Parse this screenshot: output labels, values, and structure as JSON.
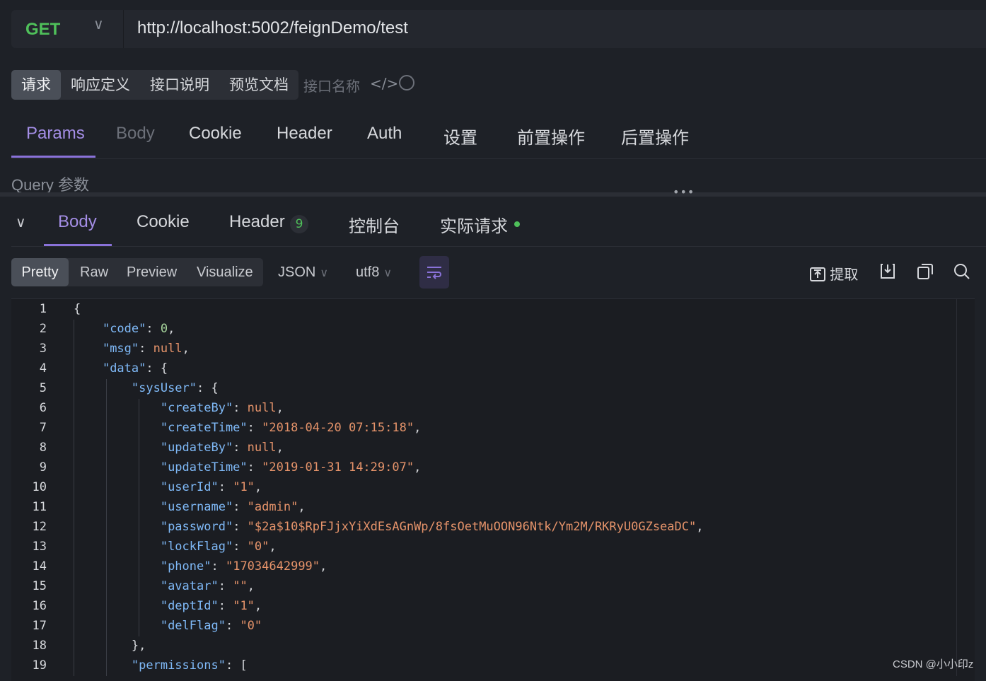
{
  "request": {
    "method": "GET",
    "url": "http://localhost:5002/feignDemo/test"
  },
  "doc_tabs": [
    "请求",
    "响应定义",
    "接口说明",
    "预览文档"
  ],
  "api_name_placeholder": "接口名称",
  "param_tabs": [
    "Params",
    "Body",
    "Cookie",
    "Header",
    "Auth",
    "设置",
    "前置操作",
    "后置操作"
  ],
  "query_label": "Query 参数",
  "response_tabs": {
    "body": "Body",
    "cookie": "Cookie",
    "header": "Header",
    "header_count": "9",
    "console": "控制台",
    "actual_request": "实际请求"
  },
  "view_tabs": [
    "Pretty",
    "Raw",
    "Preview",
    "Visualize"
  ],
  "format_select": "JSON",
  "encoding_select": "utf8",
  "toolbar": {
    "extract": "提取"
  },
  "icons": [
    "chevron-down-icon",
    "code-icon",
    "refresh-icon",
    "collapse-icon",
    "wrap-icon",
    "extract-icon",
    "download-icon",
    "copy-icon",
    "search-icon"
  ],
  "colors": {
    "accent": "#8a72d9",
    "method_get": "#4fc05a",
    "status_ok": "#4fc05a"
  },
  "code_lines": [
    "1",
    "2",
    "3",
    "4",
    "5",
    "6",
    "7",
    "8",
    "9",
    "10",
    "11",
    "12",
    "13",
    "14",
    "15",
    "16",
    "17",
    "18",
    "19"
  ],
  "json": {
    "code_key": "\"code\"",
    "code_val": "0",
    "msg_key": "\"msg\"",
    "msg_val": "null",
    "data_key": "\"data\"",
    "sysuser_key": "\"sysUser\"",
    "createBy_key": "\"createBy\"",
    "createBy_val": "null",
    "createTime_key": "\"createTime\"",
    "createTime_val": "\"2018-04-20 07:15:18\"",
    "updateBy_key": "\"updateBy\"",
    "updateBy_val": "null",
    "updateTime_key": "\"updateTime\"",
    "updateTime_val": "\"2019-01-31 14:29:07\"",
    "userId_key": "\"userId\"",
    "userId_val": "\"1\"",
    "username_key": "\"username\"",
    "username_val": "\"admin\"",
    "password_key": "\"password\"",
    "password_val": "\"$2a$10$RpFJjxYiXdEsAGnWp/8fsOetMuOON96Ntk/Ym2M/RKRyU0GZseaDC\"",
    "lockFlag_key": "\"lockFlag\"",
    "lockFlag_val": "\"0\"",
    "phone_key": "\"phone\"",
    "phone_val": "\"17034642999\"",
    "avatar_key": "\"avatar\"",
    "avatar_val": "\"\"",
    "deptId_key": "\"deptId\"",
    "deptId_val": "\"1\"",
    "delFlag_key": "\"delFlag\"",
    "delFlag_val": "\"0\"",
    "permissions_key": "\"permissions\""
  },
  "watermark": "CSDN @小小印z"
}
